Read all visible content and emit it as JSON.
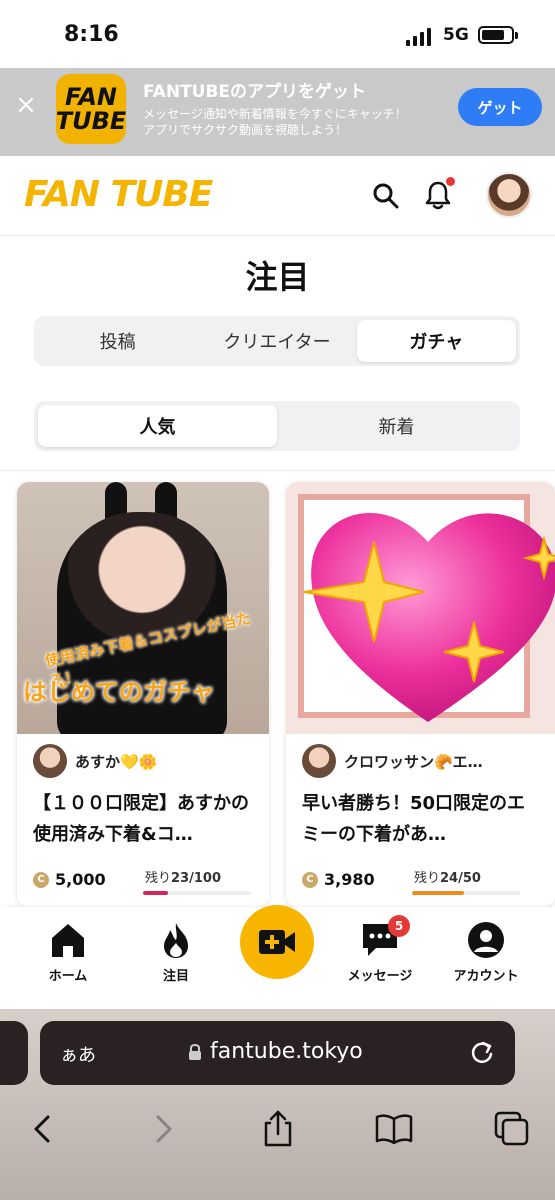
{
  "status": {
    "time": "8:16",
    "network": "5G"
  },
  "banner": {
    "logo_line1": "FAN",
    "logo_line2": "TUBE",
    "title": "FANTUBEのアプリをゲット",
    "subtitle1": "メッセージ通知や新着情報を今すぐにキャッチ！",
    "subtitle2": "アプリでサクサク動画を視聴しよう！",
    "get_label": "ゲット",
    "close": "×"
  },
  "header": {
    "logo": "FAN TUBE"
  },
  "page_title": "注目",
  "tabs": [
    {
      "label": "投稿"
    },
    {
      "label": "クリエイター"
    },
    {
      "label": "ガチャ",
      "active": true
    }
  ],
  "sort": [
    {
      "label": "人気",
      "active": true
    },
    {
      "label": "新着"
    }
  ],
  "cards": [
    {
      "caption_small": "使用済み下着＆コスプレが当たる！",
      "caption_big": "はじめてのガチャ",
      "creator": "あすか💛🌼",
      "title": "【１００口限定】あすかの使用済み下着&コ…",
      "price": "5,000",
      "remain_label": "残り",
      "remain": "23/100",
      "progress": 0.23,
      "bar_color": "#d6245a"
    },
    {
      "creator": "クロワッサン🥐エ…",
      "title": "早い者勝ち！50口限定のエミーの下着があ…",
      "price": "3,980",
      "remain_label": "残り",
      "remain": "24/50",
      "progress": 0.48,
      "bar_color": "#f08a1d"
    }
  ],
  "nav": {
    "home": "ホーム",
    "trend": "注目",
    "messages": "メッセージ",
    "messages_badge": "5",
    "account": "アカウント"
  },
  "browser": {
    "aa": "ぁあ",
    "host": "fantube.tokyo"
  }
}
